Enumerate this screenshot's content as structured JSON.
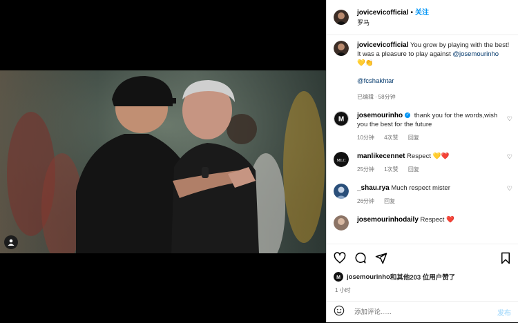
{
  "post": {
    "username": "jovicevicofficial",
    "separator": "•",
    "follow_label": "关注",
    "location": "罗马",
    "caption_line1": "You grow by playing with the best!",
    "caption_line2_prefix": "It was a pleasure to play against",
    "caption_mention1": "@josemourinho",
    "caption_emojis": "💛👏",
    "caption_mention2": "@fcshakhtar",
    "edited_label": "已编辑",
    "edited_sep": "·",
    "edited_time": "58分钟"
  },
  "comments": [
    {
      "username": "josemourinho",
      "text": "thank you for the words,wish you the best for the future",
      "time": "10分钟",
      "likes": "4次赞",
      "reply": "回复"
    },
    {
      "username": "manlikecennet",
      "text": "Respect 💛❤️",
      "time": "25分钟",
      "likes": "1次赞",
      "reply": "回复"
    },
    {
      "username": "_shau.rya",
      "text": "Much respect mister",
      "time": "26分钟",
      "likes": "",
      "reply": "回复"
    },
    {
      "username": "josemourinhodaily",
      "text": "Respect ❤️",
      "time": "",
      "likes": "",
      "reply": ""
    }
  ],
  "likes_line": {
    "username": "josemourinho",
    "rest": "和其他203 位用户赞了"
  },
  "timestamp": "1 小时",
  "add_comment": {
    "placeholder": "添加评论......",
    "post_label": "发布"
  },
  "colors": {
    "accent": "#0095f6",
    "post_disabled": "#b2dffc"
  },
  "icons": [
    "heart-icon",
    "comment-icon",
    "share-icon",
    "bookmark-icon",
    "emoji-icon",
    "user-tag-icon",
    "verified-icon"
  ]
}
